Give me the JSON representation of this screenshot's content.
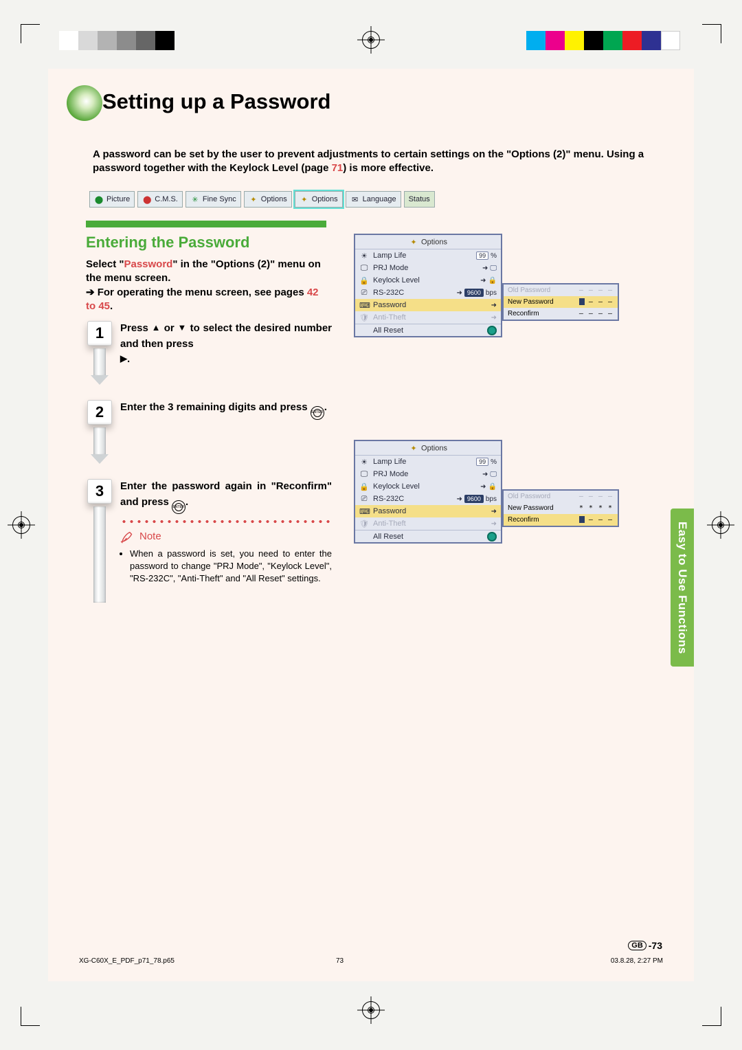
{
  "registration": {
    "gray_levels": [
      "#ffffff",
      "#d9d9d9",
      "#b3b3b3",
      "#8c8c8c",
      "#666666",
      "#000000"
    ],
    "color_bar": [
      "#00aeef",
      "#ec008c",
      "#fff200",
      "#000000",
      "#00a651",
      "#ed1c24",
      "#2e3192",
      "#ffffff"
    ]
  },
  "title": "Setting up a Password",
  "intro_1": "A password can be set by the user to prevent adjustments to certain settings on the \"Options (2)\" menu. Using a password together with the Keylock Level (page ",
  "intro_pageref": "71",
  "intro_2": ") is more effective.",
  "menubar": [
    {
      "icon": "⬤",
      "cls": "m-green",
      "label": "Picture"
    },
    {
      "icon": "⬤",
      "cls": "m-red",
      "label": "C.M.S."
    },
    {
      "icon": "✳",
      "cls": "m-green",
      "label": "Fine Sync"
    },
    {
      "icon": "✦",
      "cls": "m-yellow",
      "label": "Options"
    },
    {
      "icon": "✦",
      "cls": "m-yellow",
      "label": "Options",
      "sel": true
    },
    {
      "icon": "✉",
      "cls": "",
      "label": "Language"
    },
    {
      "icon": "",
      "cls": "",
      "label": "Status",
      "status": true
    }
  ],
  "subheading": "Entering the Password",
  "select_1": "Select \"",
  "select_red": "Password",
  "select_2": "\" in the \"Options (2)\" menu on the menu screen.",
  "select_3a": "➔ For operating the menu screen, see pages ",
  "select_3_ref": "42 to 45",
  "select_3b": ".",
  "steps": [
    {
      "n": "1",
      "body_a": "Press ",
      "body_b": " or ",
      "body_c": " to select the desired number and then press ",
      "body_d": "."
    },
    {
      "n": "2",
      "body_a": "Enter the 3 remaining digits and press ",
      "body_b": "."
    },
    {
      "n": "3",
      "body_a": "Enter the password again in \"Reconfirm\" and press ",
      "body_b": "."
    }
  ],
  "note_label": "Note",
  "note_body": "When a password is set, you need to enter the password to change \"PRJ Mode\", \"Keylock Level\", \"RS-232C\", \"Anti-Theft\" and \"All Reset\" settings.",
  "osd_title_icon": "✦",
  "osd_title": "Options",
  "osd_rows": [
    {
      "icon": "☀",
      "label": "Lamp Life",
      "val_badge": "99",
      "val_suffix": "%"
    },
    {
      "icon": "🖵",
      "label": "PRJ Mode",
      "arrow": true,
      "screen": true
    },
    {
      "icon": "🔒",
      "label": "Keylock Level",
      "arrow": true,
      "lock": true
    },
    {
      "icon": "⎚",
      "label": "RS-232C",
      "arrow": true,
      "badge_dark": "9600",
      "suffix": "bps"
    },
    {
      "icon": "⌨",
      "label": "Password",
      "arrow": true,
      "hi": true
    },
    {
      "icon": "🛡",
      "label": "Anti-Theft",
      "arrow": true,
      "dim": true
    },
    {
      "icon": "",
      "label": "All Reset",
      "circle": true,
      "last": true
    }
  ],
  "pw_labels": {
    "old": "Old Password",
    "new": "New Password",
    "re": "Reconfirm"
  },
  "pw_panel_1": {
    "old": [
      "–",
      "–",
      "–",
      "–"
    ],
    "new_cursor": true,
    "new": [
      "–",
      "–",
      "–"
    ],
    "re": [
      "–",
      "–",
      "–",
      "–"
    ]
  },
  "pw_panel_2": {
    "old": [
      "–",
      "–",
      "–",
      "–"
    ],
    "new": [
      "*",
      "*",
      "*",
      "*"
    ],
    "re_cursor": true,
    "re": [
      "–",
      "–",
      "–"
    ]
  },
  "sidetab": "Easy to Use Functions",
  "page_gb": "GB",
  "page_num": "-73",
  "footer": {
    "left": "XG-C60X_E_PDF_p71_78.p65",
    "mid": "73",
    "right": "03.8.28, 2:27 PM"
  }
}
